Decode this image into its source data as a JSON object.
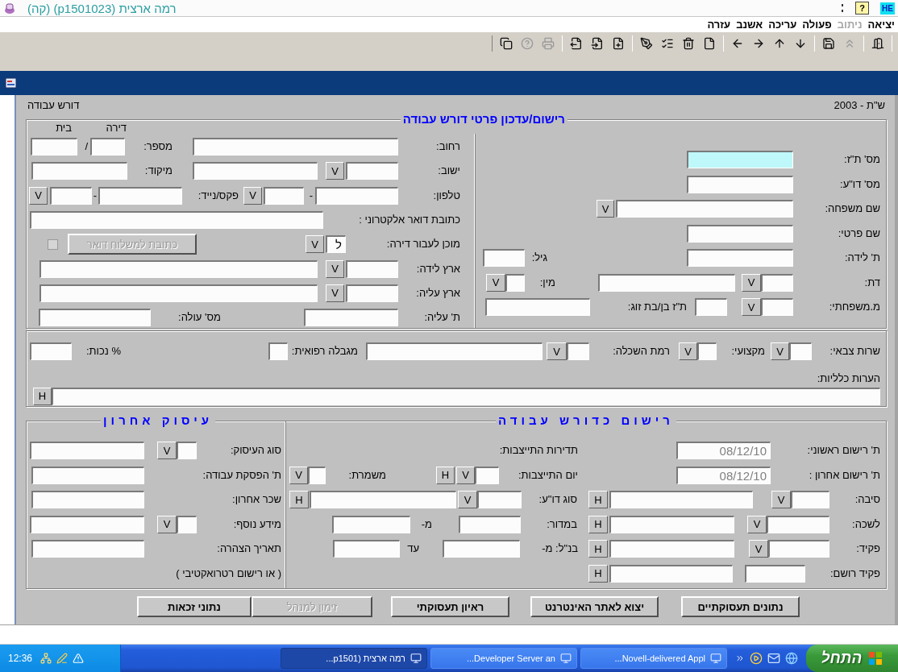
{
  "window": {
    "title": "רמה ארצית (p1501023) (קה)",
    "help": "?",
    "language": "HE"
  },
  "menu": [
    {
      "label": "יציאה",
      "disabled": false
    },
    {
      "label": "ניתוב",
      "disabled": true
    },
    {
      "label": "פעולה",
      "disabled": false
    },
    {
      "label": "עריכה",
      "disabled": false
    },
    {
      "label": "אשנב",
      "disabled": false
    },
    {
      "label": "עזרה",
      "disabled": false
    }
  ],
  "toolbar": [
    [
      {
        "kind": "exit",
        "disabled": false
      }
    ],
    [
      {
        "kind": "clear",
        "disabled": true
      },
      {
        "kind": "save",
        "disabled": false
      }
    ],
    [
      {
        "kind": "down",
        "disabled": false
      },
      {
        "kind": "up",
        "disabled": false
      },
      {
        "kind": "right",
        "disabled": false
      },
      {
        "kind": "left",
        "disabled": false
      }
    ],
    [
      {
        "kind": "new",
        "disabled": false
      },
      {
        "kind": "delete",
        "disabled": false
      },
      {
        "kind": "list",
        "disabled": false
      },
      {
        "kind": "edit",
        "disabled": false
      }
    ],
    [
      {
        "kind": "insert",
        "disabled": false
      },
      {
        "kind": "import",
        "disabled": false
      },
      {
        "kind": "export",
        "disabled": false
      }
    ],
    [
      {
        "kind": "print",
        "disabled": true
      },
      {
        "kind": "help",
        "disabled": true
      },
      {
        "kind": "copy",
        "disabled": false
      }
    ]
  ],
  "header": {
    "version": "ש\"ת - 2003",
    "form_name": "דורש עבודה"
  },
  "personal": {
    "title": "רישום/עדכון פרטי דורש עבודה",
    "lines": [
      {
        "items": [
          {
            "kind": "label",
            "text": "מס' ת\"ז:"
          },
          {
            "kind": "field",
            "focused": true
          }
        ]
      },
      {
        "items": [
          {
            "kind": "label",
            "text": "מס' דו\"ע:"
          },
          {
            "kind": "field"
          }
        ]
      },
      {
        "items": [
          {
            "kind": "label",
            "text": "שם משפחה:"
          },
          {
            "kind": "field"
          },
          {
            "kind": "lookup",
            "label": "V"
          }
        ]
      },
      {
        "items": [
          {
            "kind": "label",
            "text": "שם פרטי:"
          },
          {
            "kind": "field"
          }
        ]
      },
      {
        "items": [
          {
            "kind": "label",
            "text": "ת' לידה:"
          },
          {
            "kind": "field"
          },
          {
            "kind": "label",
            "text": "גיל:"
          },
          {
            "kind": "field"
          }
        ]
      },
      {
        "items": [
          {
            "kind": "label",
            "text": "דת:"
          },
          {
            "kind": "field"
          },
          {
            "kind": "lookup",
            "label": "V"
          },
          {
            "kind": "field"
          },
          {
            "kind": "label",
            "text": "מין:"
          },
          {
            "kind": "field"
          },
          {
            "kind": "lookup",
            "label": "V"
          }
        ]
      },
      {
        "items": [
          {
            "kind": "label",
            "text": "מ.משפחתי:"
          },
          {
            "kind": "field"
          },
          {
            "kind": "lookup",
            "label": "V"
          },
          {
            "kind": "field"
          },
          {
            "kind": "label",
            "text": "ת\"ז בן/בת זוג:"
          },
          {
            "kind": "field"
          }
        ]
      }
    ]
  },
  "address": {
    "headings": [
      "דירה",
      "בית"
    ],
    "lines": [
      {
        "items": [
          {
            "kind": "label",
            "text": "רחוב:"
          },
          {
            "kind": "field"
          },
          {
            "kind": "label",
            "text": "מספר:"
          },
          {
            "kind": "field"
          },
          {
            "kind": "label",
            "text": "/"
          },
          {
            "kind": "field"
          }
        ]
      },
      {
        "items": [
          {
            "kind": "label",
            "text": "ישוב:"
          },
          {
            "kind": "field"
          },
          {
            "kind": "lookup",
            "label": "V"
          },
          {
            "kind": "field"
          },
          {
            "kind": "label",
            "text": "מיקוד:"
          },
          {
            "kind": "field"
          }
        ]
      },
      {
        "items": [
          {
            "kind": "label",
            "text": "טלפון:"
          },
          {
            "kind": "field"
          },
          {
            "kind": "label",
            "text": "-"
          },
          {
            "kind": "field"
          },
          {
            "kind": "lookup",
            "label": "V"
          },
          {
            "kind": "label",
            "text": "פקס/נייד:"
          },
          {
            "kind": "field"
          },
          {
            "kind": "label",
            "text": "-"
          },
          {
            "kind": "field"
          },
          {
            "kind": "lookup",
            "label": "V"
          }
        ]
      },
      {
        "items": [
          {
            "kind": "label",
            "text": "כתובת דואר אלקטרוני :"
          },
          {
            "kind": "field"
          }
        ]
      },
      {
        "items": [
          {
            "kind": "label",
            "text": "מוכן לעבור דירה:"
          },
          {
            "kind": "field",
            "value": "ל"
          },
          {
            "kind": "lookup",
            "label": "V"
          },
          {
            "kind": "button",
            "label": "כתובת למשלוח דואר",
            "disabled": true
          },
          {
            "kind": "checkbox",
            "checked": false,
            "disabled": true
          }
        ]
      },
      {
        "items": [
          {
            "kind": "label",
            "text": "ארץ לידה:"
          },
          {
            "kind": "field"
          },
          {
            "kind": "lookup",
            "label": "V"
          },
          {
            "kind": "field"
          }
        ]
      },
      {
        "items": [
          {
            "kind": "label",
            "text": "ארץ עליה:"
          },
          {
            "kind": "field"
          },
          {
            "kind": "lookup",
            "label": "V"
          },
          {
            "kind": "field"
          }
        ]
      },
      {
        "items": [
          {
            "kind": "label",
            "text": "ת' עליה:"
          },
          {
            "kind": "field"
          },
          {
            "kind": "label",
            "text": "מס' עולה:"
          },
          {
            "kind": "field"
          }
        ]
      }
    ]
  },
  "general": {
    "lines": [
      {
        "items": [
          {
            "kind": "label",
            "text": "שרות צבאי:"
          },
          {
            "kind": "field"
          },
          {
            "kind": "lookup",
            "label": "V"
          },
          {
            "kind": "label",
            "text": "מקצועי:"
          },
          {
            "kind": "field"
          },
          {
            "kind": "lookup",
            "label": "V"
          },
          {
            "kind": "label",
            "text": "רמת השכלה:"
          },
          {
            "kind": "field"
          },
          {
            "kind": "lookup",
            "label": "V"
          },
          {
            "kind": "field"
          },
          {
            "kind": "label",
            "text": "מגבלה רפואית:"
          },
          {
            "kind": "field"
          },
          {
            "kind": "label",
            "text": "% נכות:"
          },
          {
            "kind": "field"
          }
        ]
      },
      {
        "items": [
          {
            "kind": "label",
            "text": "הערות כלליות:"
          }
        ]
      },
      {
        "items": [
          {
            "kind": "field"
          },
          {
            "kind": "lookup",
            "label": "H"
          }
        ]
      }
    ]
  },
  "registration": {
    "title": "רישום כדורש עבודה",
    "lines": [
      {
        "items": [
          {
            "kind": "label",
            "text": "ת' רישום ראשוני:"
          },
          {
            "kind": "field",
            "value": "08/12/10",
            "disabled": true
          },
          {
            "kind": "label",
            "text": "תדירות התייצבות:"
          }
        ]
      },
      {
        "items": [
          {
            "kind": "label",
            "text": "ת' רישום אחרון :"
          },
          {
            "kind": "field",
            "value": "08/12/10",
            "disabled": true
          },
          {
            "kind": "label",
            "text": "יום התייצבות:"
          },
          {
            "kind": "field"
          },
          {
            "kind": "lookup",
            "label": "V"
          },
          {
            "kind": "lookup",
            "label": "H"
          },
          {
            "kind": "label",
            "text": "משמרת:"
          },
          {
            "kind": "field"
          },
          {
            "kind": "lookup",
            "label": "V"
          }
        ]
      },
      {
        "items": [
          {
            "kind": "label",
            "text": "סיבה:"
          },
          {
            "kind": "field"
          },
          {
            "kind": "lookup",
            "label": "V"
          },
          {
            "kind": "field"
          },
          {
            "kind": "lookup",
            "label": "H"
          },
          {
            "kind": "label",
            "text": "סוג דו\"ע:"
          },
          {
            "kind": "field"
          },
          {
            "kind": "lookup",
            "label": "V"
          },
          {
            "kind": "field"
          },
          {
            "kind": "lookup",
            "label": "H"
          }
        ]
      },
      {
        "items": [
          {
            "kind": "label",
            "text": "לשכה:"
          },
          {
            "kind": "field"
          },
          {
            "kind": "lookup",
            "label": "V"
          },
          {
            "kind": "field"
          },
          {
            "kind": "lookup",
            "label": "H"
          },
          {
            "kind": "label",
            "text": "במדור:"
          },
          {
            "kind": "field"
          },
          {
            "kind": "label",
            "text": "מ-"
          },
          {
            "kind": "field"
          }
        ]
      },
      {
        "items": [
          {
            "kind": "label",
            "text": "פקיד:"
          },
          {
            "kind": "field"
          },
          {
            "kind": "lookup",
            "label": "V"
          },
          {
            "kind": "field"
          },
          {
            "kind": "lookup",
            "label": "H"
          },
          {
            "kind": "label",
            "text": "בנ\"ל: מ-"
          },
          {
            "kind": "field"
          },
          {
            "kind": "label",
            "text": "עד"
          },
          {
            "kind": "field"
          }
        ]
      },
      {
        "items": [
          {
            "kind": "label",
            "text": "פקיד רושם:"
          },
          {
            "kind": "field"
          },
          {
            "kind": "field"
          },
          {
            "kind": "lookup",
            "label": "H"
          }
        ]
      }
    ]
  },
  "last_job": {
    "title": "עיסוק אחרון",
    "lines": [
      {
        "items": [
          {
            "kind": "label",
            "text": "סוג העיסוק:"
          },
          {
            "kind": "field"
          },
          {
            "kind": "lookup",
            "label": "V"
          },
          {
            "kind": "field"
          }
        ]
      },
      {
        "items": [
          {
            "kind": "label",
            "text": "ת' הפסקת עבודה:"
          },
          {
            "kind": "field"
          }
        ]
      },
      {
        "items": [
          {
            "kind": "label",
            "text": "שכר אחרון:"
          },
          {
            "kind": "field"
          }
        ]
      },
      {
        "items": [
          {
            "kind": "label",
            "text": "מידע נוסף:"
          },
          {
            "kind": "field"
          },
          {
            "kind": "lookup",
            "label": "V"
          },
          {
            "kind": "field"
          }
        ]
      },
      {
        "items": [
          {
            "kind": "label",
            "text": "תאריך הצהרה:"
          },
          {
            "kind": "field"
          }
        ]
      },
      {
        "items": [
          {
            "kind": "label",
            "text": "( או רישום רטרואקטיבי )"
          }
        ]
      }
    ]
  },
  "actions": [
    {
      "label": "נתונים תעסוקתיים",
      "disabled": false
    },
    {
      "label": "יצוא לאתר האינטרנט",
      "disabled": false
    },
    {
      "label": "ראיון תעסוקתי",
      "disabled": false
    },
    {
      "label": "זימון למנהל",
      "disabled": true
    },
    {
      "label": "נתוני זכאות",
      "disabled": false
    }
  ],
  "taskbar": {
    "start": "התחל",
    "tasks": [
      {
        "label": "...Novell-delivered Appl",
        "selected": false
      },
      {
        "label": "...Developer Server an",
        "selected": false
      },
      {
        "label": "רמה ארצית (p1501...",
        "selected": true
      }
    ],
    "clock": "12:36"
  }
}
